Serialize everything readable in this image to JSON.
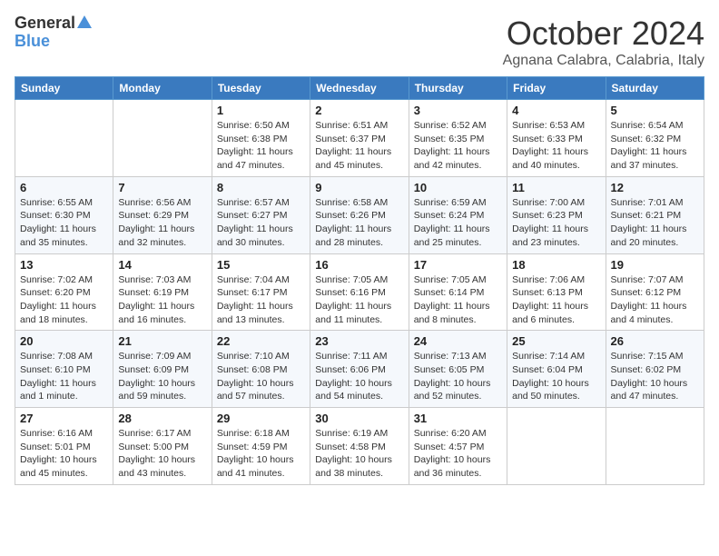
{
  "header": {
    "logo_general": "General",
    "logo_blue": "Blue",
    "month_title": "October 2024",
    "location": "Agnana Calabra, Calabria, Italy"
  },
  "days_of_week": [
    "Sunday",
    "Monday",
    "Tuesday",
    "Wednesday",
    "Thursday",
    "Friday",
    "Saturday"
  ],
  "weeks": [
    [
      {
        "day": "",
        "info": ""
      },
      {
        "day": "",
        "info": ""
      },
      {
        "day": "1",
        "info": "Sunrise: 6:50 AM\nSunset: 6:38 PM\nDaylight: 11 hours and 47 minutes."
      },
      {
        "day": "2",
        "info": "Sunrise: 6:51 AM\nSunset: 6:37 PM\nDaylight: 11 hours and 45 minutes."
      },
      {
        "day": "3",
        "info": "Sunrise: 6:52 AM\nSunset: 6:35 PM\nDaylight: 11 hours and 42 minutes."
      },
      {
        "day": "4",
        "info": "Sunrise: 6:53 AM\nSunset: 6:33 PM\nDaylight: 11 hours and 40 minutes."
      },
      {
        "day": "5",
        "info": "Sunrise: 6:54 AM\nSunset: 6:32 PM\nDaylight: 11 hours and 37 minutes."
      }
    ],
    [
      {
        "day": "6",
        "info": "Sunrise: 6:55 AM\nSunset: 6:30 PM\nDaylight: 11 hours and 35 minutes."
      },
      {
        "day": "7",
        "info": "Sunrise: 6:56 AM\nSunset: 6:29 PM\nDaylight: 11 hours and 32 minutes."
      },
      {
        "day": "8",
        "info": "Sunrise: 6:57 AM\nSunset: 6:27 PM\nDaylight: 11 hours and 30 minutes."
      },
      {
        "day": "9",
        "info": "Sunrise: 6:58 AM\nSunset: 6:26 PM\nDaylight: 11 hours and 28 minutes."
      },
      {
        "day": "10",
        "info": "Sunrise: 6:59 AM\nSunset: 6:24 PM\nDaylight: 11 hours and 25 minutes."
      },
      {
        "day": "11",
        "info": "Sunrise: 7:00 AM\nSunset: 6:23 PM\nDaylight: 11 hours and 23 minutes."
      },
      {
        "day": "12",
        "info": "Sunrise: 7:01 AM\nSunset: 6:21 PM\nDaylight: 11 hours and 20 minutes."
      }
    ],
    [
      {
        "day": "13",
        "info": "Sunrise: 7:02 AM\nSunset: 6:20 PM\nDaylight: 11 hours and 18 minutes."
      },
      {
        "day": "14",
        "info": "Sunrise: 7:03 AM\nSunset: 6:19 PM\nDaylight: 11 hours and 16 minutes."
      },
      {
        "day": "15",
        "info": "Sunrise: 7:04 AM\nSunset: 6:17 PM\nDaylight: 11 hours and 13 minutes."
      },
      {
        "day": "16",
        "info": "Sunrise: 7:05 AM\nSunset: 6:16 PM\nDaylight: 11 hours and 11 minutes."
      },
      {
        "day": "17",
        "info": "Sunrise: 7:05 AM\nSunset: 6:14 PM\nDaylight: 11 hours and 8 minutes."
      },
      {
        "day": "18",
        "info": "Sunrise: 7:06 AM\nSunset: 6:13 PM\nDaylight: 11 hours and 6 minutes."
      },
      {
        "day": "19",
        "info": "Sunrise: 7:07 AM\nSunset: 6:12 PM\nDaylight: 11 hours and 4 minutes."
      }
    ],
    [
      {
        "day": "20",
        "info": "Sunrise: 7:08 AM\nSunset: 6:10 PM\nDaylight: 11 hours and 1 minute."
      },
      {
        "day": "21",
        "info": "Sunrise: 7:09 AM\nSunset: 6:09 PM\nDaylight: 10 hours and 59 minutes."
      },
      {
        "day": "22",
        "info": "Sunrise: 7:10 AM\nSunset: 6:08 PM\nDaylight: 10 hours and 57 minutes."
      },
      {
        "day": "23",
        "info": "Sunrise: 7:11 AM\nSunset: 6:06 PM\nDaylight: 10 hours and 54 minutes."
      },
      {
        "day": "24",
        "info": "Sunrise: 7:13 AM\nSunset: 6:05 PM\nDaylight: 10 hours and 52 minutes."
      },
      {
        "day": "25",
        "info": "Sunrise: 7:14 AM\nSunset: 6:04 PM\nDaylight: 10 hours and 50 minutes."
      },
      {
        "day": "26",
        "info": "Sunrise: 7:15 AM\nSunset: 6:02 PM\nDaylight: 10 hours and 47 minutes."
      }
    ],
    [
      {
        "day": "27",
        "info": "Sunrise: 6:16 AM\nSunset: 5:01 PM\nDaylight: 10 hours and 45 minutes."
      },
      {
        "day": "28",
        "info": "Sunrise: 6:17 AM\nSunset: 5:00 PM\nDaylight: 10 hours and 43 minutes."
      },
      {
        "day": "29",
        "info": "Sunrise: 6:18 AM\nSunset: 4:59 PM\nDaylight: 10 hours and 41 minutes."
      },
      {
        "day": "30",
        "info": "Sunrise: 6:19 AM\nSunset: 4:58 PM\nDaylight: 10 hours and 38 minutes."
      },
      {
        "day": "31",
        "info": "Sunrise: 6:20 AM\nSunset: 4:57 PM\nDaylight: 10 hours and 36 minutes."
      },
      {
        "day": "",
        "info": ""
      },
      {
        "day": "",
        "info": ""
      }
    ]
  ]
}
